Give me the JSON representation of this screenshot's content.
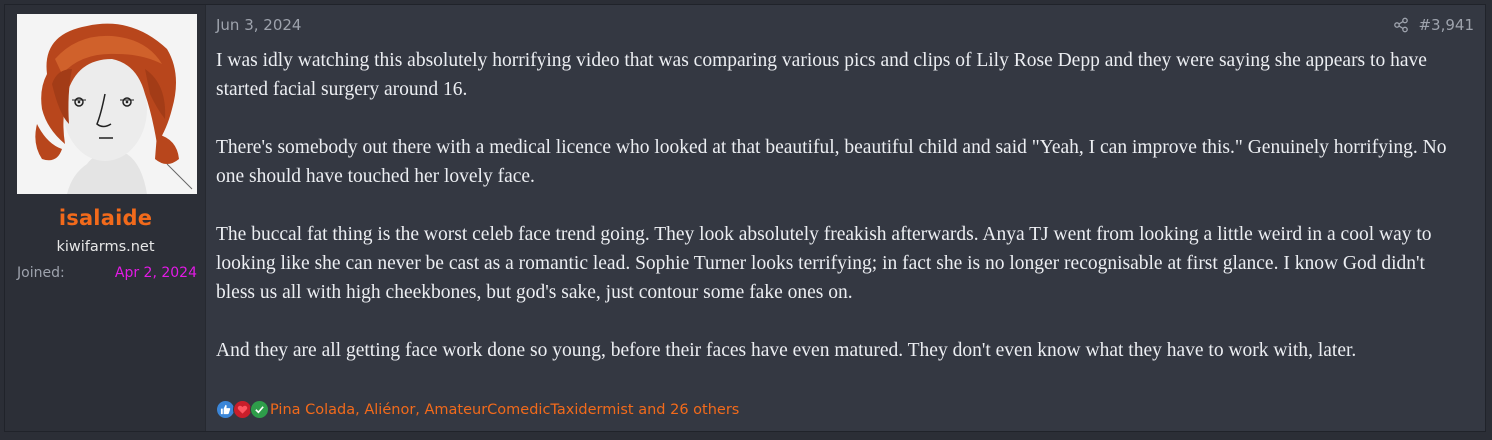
{
  "user": {
    "name": "isalaide",
    "title": "kiwifarms.net",
    "joined_label": "Joined:",
    "joined_value": "Apr 2, 2024"
  },
  "post": {
    "date": "Jun 3, 2024",
    "number": "#3,941",
    "paragraphs": [
      "I was idly watching this absolutely horrifying video that was comparing various pics and clips of Lily Rose Depp and they were saying she appears to have started facial surgery around 16.",
      "There's somebody out there with a medical licence who looked at that beautiful, beautiful child and said \"Yeah, I can improve this.\" Genuinely horrifying. No one should have touched her lovely face.",
      "The buccal fat thing is the worst celeb face trend going. They look absolutely freakish afterwards. Anya TJ went from looking a little weird in a cool way to looking like she can never be cast as a romantic lead. Sophie Turner looks terrifying; in fact she is no longer recognisable at first glance. I know God didn't bless us all with high cheekbones, but god's sake, just contour some fake ones on.",
      "And they are all getting face work done so young, before their faces have even matured. They don't even know what they have to work with, later."
    ]
  },
  "reactions": {
    "icons": [
      "thumbs-up-icon",
      "heart-icon",
      "check-icon"
    ],
    "text": "Pina Colada, Aliénor, AmateurComedicTaxidermist and 26 others"
  },
  "colors": {
    "background": "#343842",
    "username": "#f26a1b",
    "joined_date": "#e21ae5",
    "body_text": "#eceef2",
    "muted": "#9ea3ad"
  }
}
